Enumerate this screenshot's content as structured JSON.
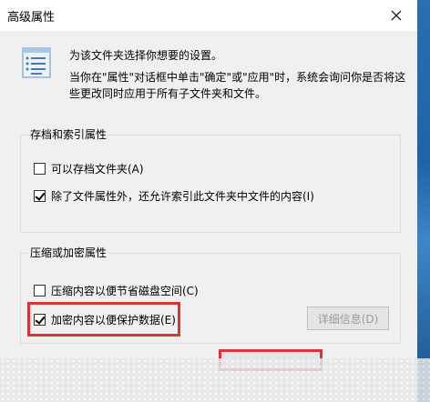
{
  "window": {
    "title": "高级属性",
    "close_icon": "close-icon"
  },
  "info": {
    "icon": "folder-properties-icon",
    "line1": "为该文件夹选择你想要的设置。",
    "line2": "当你在\"属性\"对话框中单击\"确定\"或\"应用\"时，系统会询问你是否将这",
    "line3": "些更改同时应用于所有子文件夹和文件。"
  },
  "archive_group": {
    "title": "存档和索引属性",
    "items": [
      {
        "label": "可以存档文件夹(A)",
        "checked": false
      },
      {
        "label": "除了文件属性外，还允许索引此文件夹中文件的内容(I)",
        "checked": true
      }
    ]
  },
  "compress_group": {
    "title": "压缩或加密属性",
    "items": [
      {
        "label": "压缩内容以便节省磁盘空间(C)",
        "checked": false
      },
      {
        "label": "加密内容以便保护数据(E)",
        "checked": true
      }
    ],
    "details_button": "详细信息(D)"
  },
  "colors": {
    "highlight": "#d9343a"
  }
}
